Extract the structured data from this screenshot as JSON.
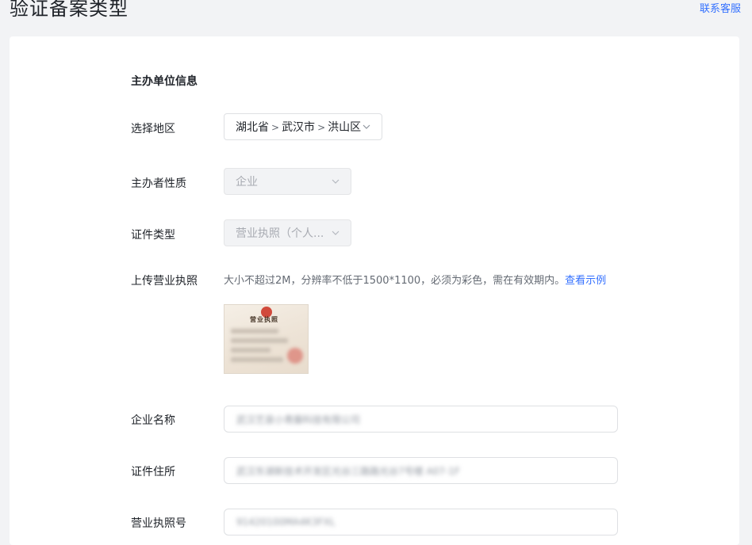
{
  "header": {
    "title": "验证备案类型",
    "contact_label": "联系客服"
  },
  "form": {
    "section_title": "主办单位信息",
    "region": {
      "label": "选择地区",
      "province": "湖北省",
      "city": "武汉市",
      "district": "洪山区",
      "separator": ">"
    },
    "host_type": {
      "label": "主办者性质",
      "value": "企业"
    },
    "cert_type": {
      "label": "证件类型",
      "value": "营业执照（个人..."
    },
    "license_upload": {
      "label": "上传营业执照",
      "hint": "大小不超过2M，分辨率不低于1500*1100，必须为彩色，需在有效期内。",
      "example_link": "查看示例",
      "thumbnail_title": "营业执照"
    },
    "company_name": {
      "label": "企业名称",
      "value": "武汉艺泉小青藤科技有限公司"
    },
    "cert_address": {
      "label": "证件住所",
      "value": "武汉东湖新技术开发区光谷三路路光谷7号楼 A07-1F"
    },
    "license_number": {
      "label": "营业执照号",
      "value": "91420100MA4K3FXL"
    }
  },
  "colors": {
    "accent": "#3370ff",
    "page_bg": "#f2f3f5",
    "card_bg": "#ffffff"
  },
  "icons": {
    "dropdown": "chevron-down-icon",
    "region_separator": "chevron-right-icon",
    "emblem": "national-emblem-icon"
  }
}
